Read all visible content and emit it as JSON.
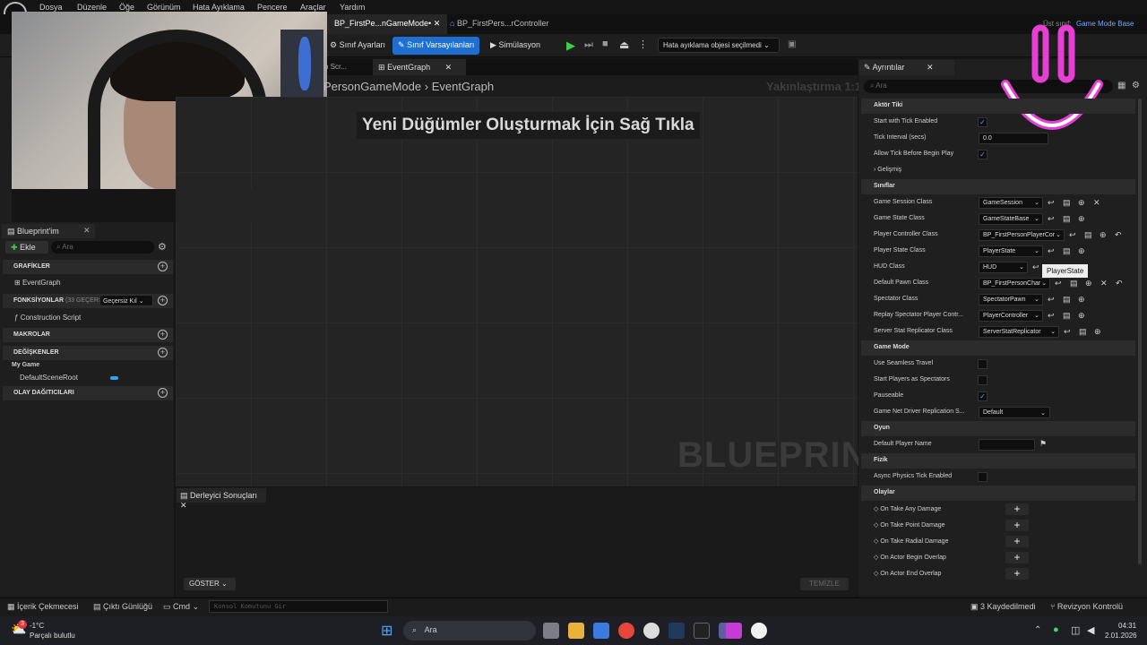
{
  "menu": [
    "Dosya",
    "Düzenle",
    "Öğe",
    "Görünüm",
    "Hata Ayıklama",
    "Pencere",
    "Araçlar",
    "Yardım"
  ],
  "tabs": {
    "bp_game_mode": "BP_FirstPe...nGameMode•",
    "bp_controller": "BP_FirstPers...rController"
  },
  "parent_class": {
    "label": "Üst sınıf:",
    "value": "Game Mode Base"
  },
  "toolbar": {
    "class_settings": "Sınıf Ayarları",
    "class_defaults": "Sınıf Varsayılanları",
    "simulation": "Simülasyon",
    "debug_object": "Hata ayıklama objesi seçilmedi"
  },
  "graph": {
    "tab_construction": "n Scr...",
    "tab_event": "EventGraph",
    "breadcrumb_parent": "PersonGameMode",
    "breadcrumb_current": "EventGraph",
    "zoom": "Yakınlaştırma 1:1",
    "hint": "Yeni Düğümler Oluşturmak İçin Sağ Tıkla",
    "watermark": "BLUEPRINT"
  },
  "my_blueprint": {
    "tab": "Blueprint'im",
    "add": "Ekle",
    "search_placeholder": "Ara",
    "graphs": "GRAFİKLER",
    "event_graph": "EventGraph",
    "functions": "FONKSİYONLAR",
    "functions_count": "(33 GEÇERSİ",
    "override": "Geçersiz Kıl",
    "construction_script": "Construction Script",
    "macros": "MAKROLAR",
    "variables": "DEĞİŞKENLER",
    "my_game": "My Game",
    "default_scene_root": "DefaultSceneRoot",
    "dispatchers": "OLAY DAĞITICILARI"
  },
  "compiler": {
    "tab": "Derleyici Sonuçları",
    "show": "GÖSTER",
    "clear": "TEMİZLE"
  },
  "details": {
    "tab": "Ayrıntılar",
    "search_placeholder": "Ara",
    "cat_actor_tick": "Aktör Tiki",
    "start_tick": "Start with Tick Enabled",
    "tick_interval": "Tick Interval (secs)",
    "tick_interval_value": "0.0",
    "allow_tick": "Allow Tick Before Begin Play",
    "advanced": "Gelişmiş",
    "cat_classes": "Sınıflar",
    "classes": [
      {
        "label": "Game Session Class",
        "value": "GameSession"
      },
      {
        "label": "Game State Class",
        "value": "GameStateBase"
      },
      {
        "label": "Player Controller Class",
        "value": "BP_FirstPersonPlayerCor"
      },
      {
        "label": "Player State Class",
        "value": "PlayerState"
      },
      {
        "label": "HUD Class",
        "value": "HUD"
      },
      {
        "label": "Default Pawn Class",
        "value": "BP_FirstPersonChar"
      },
      {
        "label": "Spectator Class",
        "value": "SpectatorPawn"
      },
      {
        "label": "Replay Spectator Player Contr...",
        "value": "PlayerController"
      },
      {
        "label": "Server Stat Replicator Class",
        "value": "ServerStatReplicator"
      }
    ],
    "tooltip": "PlayerState",
    "cat_game_mode": "Game Mode",
    "seamless": "Use Seamless Travel",
    "spectators": "Start Players as Spectators",
    "pauseable": "Pauseable",
    "net_driver": "Game Net Driver Replication S...",
    "net_driver_value": "Default",
    "cat_game": "Oyun",
    "default_player_name": "Default Player Name",
    "cat_physics": "Fizik",
    "async_physics": "Async Physics Tick Enabled",
    "cat_events": "Olaylar",
    "events": [
      "On Take Any Damage",
      "On Take Point Damage",
      "On Take Radial Damage",
      "On Actor Begin Overlap",
      "On Actor End Overlap"
    ]
  },
  "status": {
    "content_drawer": "İçerik Çekmecesi",
    "output_log": "Çıktı Günlüğü",
    "cmd": "Cmd",
    "console_placeholder": "Konsol Komutunu Gir",
    "saved": "3 Kaydedilmedi",
    "revision": "Revizyon Kontrolü"
  },
  "taskbar": {
    "temp": "-1°C",
    "weather": "Parçalı bulutlu",
    "search": "Ara",
    "badge": "3",
    "time": "04:31",
    "date": "2.01.2026"
  }
}
